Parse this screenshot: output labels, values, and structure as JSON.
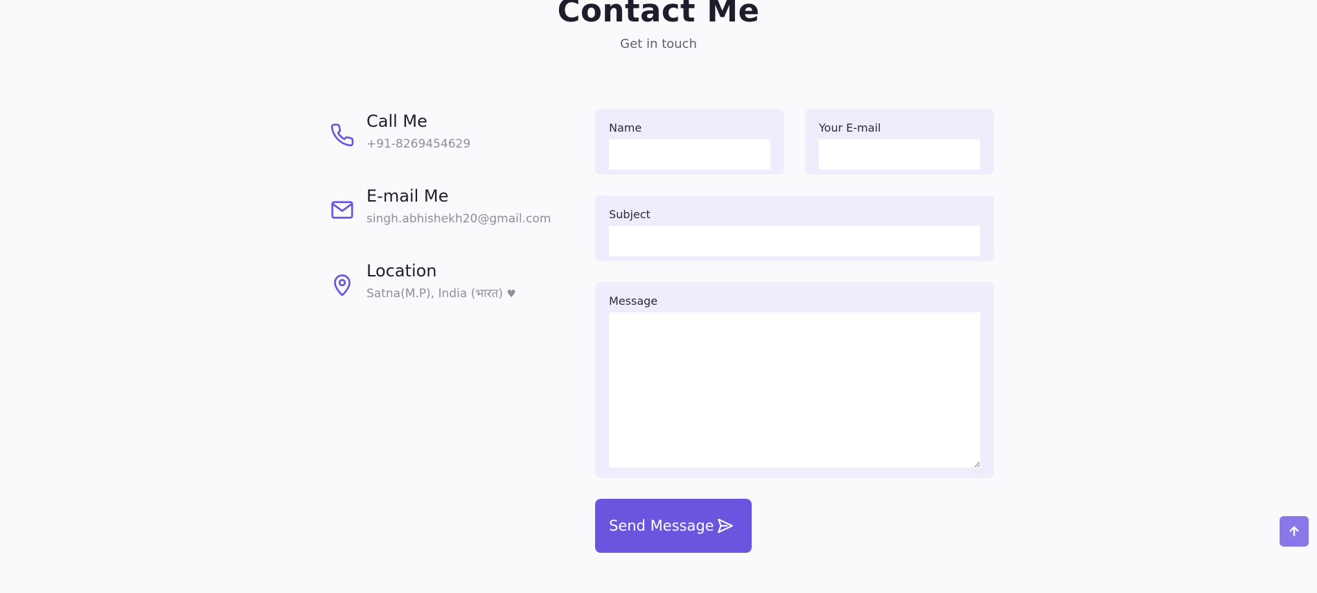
{
  "header": {
    "title": "Contact Me",
    "subtitle": "Get in touch"
  },
  "contact_info": [
    {
      "icon": "phone-icon",
      "title": "Call Me",
      "value": "+91-8269454629"
    },
    {
      "icon": "mail-icon",
      "title": "E-mail Me",
      "value": "singh.abhishekh20@gmail.com"
    },
    {
      "icon": "map-pin-icon",
      "title": "Location",
      "value": "Satna(M.P), India (भारत)",
      "extra_icon": "heart-icon"
    }
  ],
  "form": {
    "name_label": "Name",
    "name_value": "",
    "email_label": "Your E-mail",
    "email_value": "",
    "subject_label": "Subject",
    "subject_value": "",
    "message_label": "Message",
    "message_value": "",
    "submit_label": "Send Message",
    "submit_icon": "send-icon"
  },
  "scroll_top": {
    "icon": "arrow-up-icon"
  },
  "colors": {
    "accent": "#6a55de",
    "accent_light": "#8a78e8",
    "field_bg": "#efedfb",
    "page_bg": "#fafafc",
    "muted_text": "#8f8d9b"
  }
}
